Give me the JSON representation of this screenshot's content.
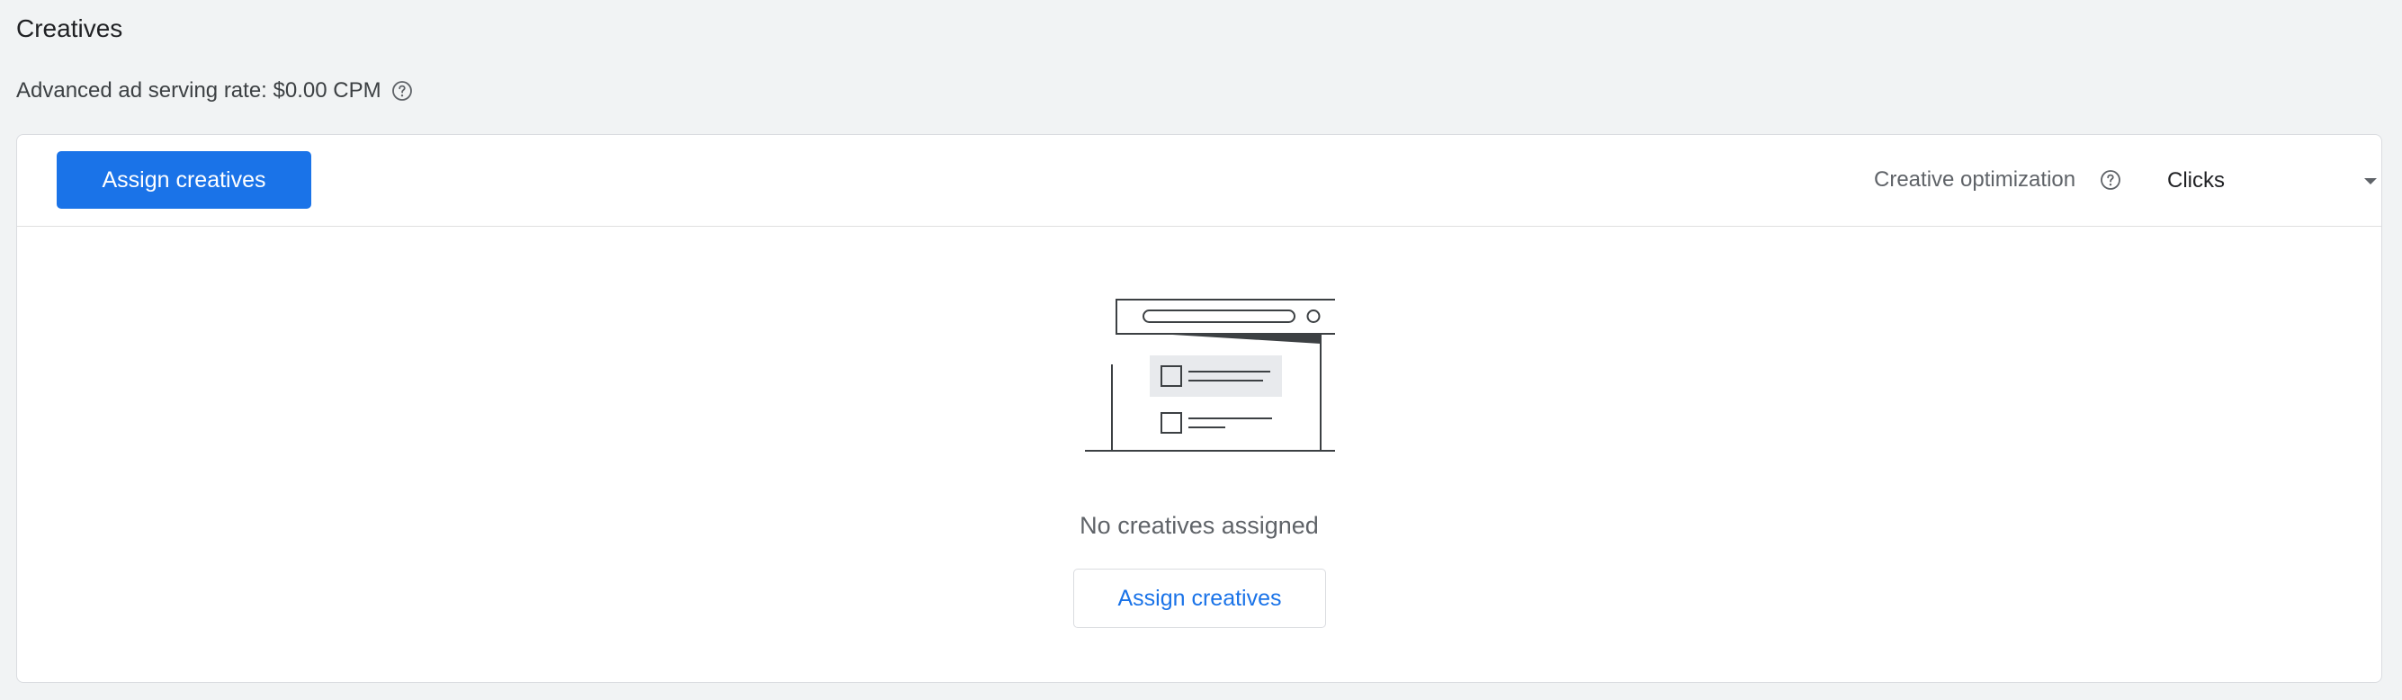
{
  "page": {
    "title": "Creatives",
    "serving_rate_text": "Advanced ad serving rate: $0.00 CPM"
  },
  "header": {
    "assign_button_label": "Assign creatives",
    "optimization_label": "Creative optimization",
    "optimization_value": "Clicks"
  },
  "empty_state": {
    "message": "No creatives assigned",
    "assign_button_label": "Assign creatives"
  },
  "icons": {
    "help": "help-circle-icon",
    "dropdown": "dropdown-arrow-icon",
    "illustration": "empty-creatives-illustration"
  },
  "colors": {
    "primary": "#1a73e8",
    "background": "#f1f3f4",
    "card": "#ffffff",
    "text_secondary": "#5f6368"
  }
}
